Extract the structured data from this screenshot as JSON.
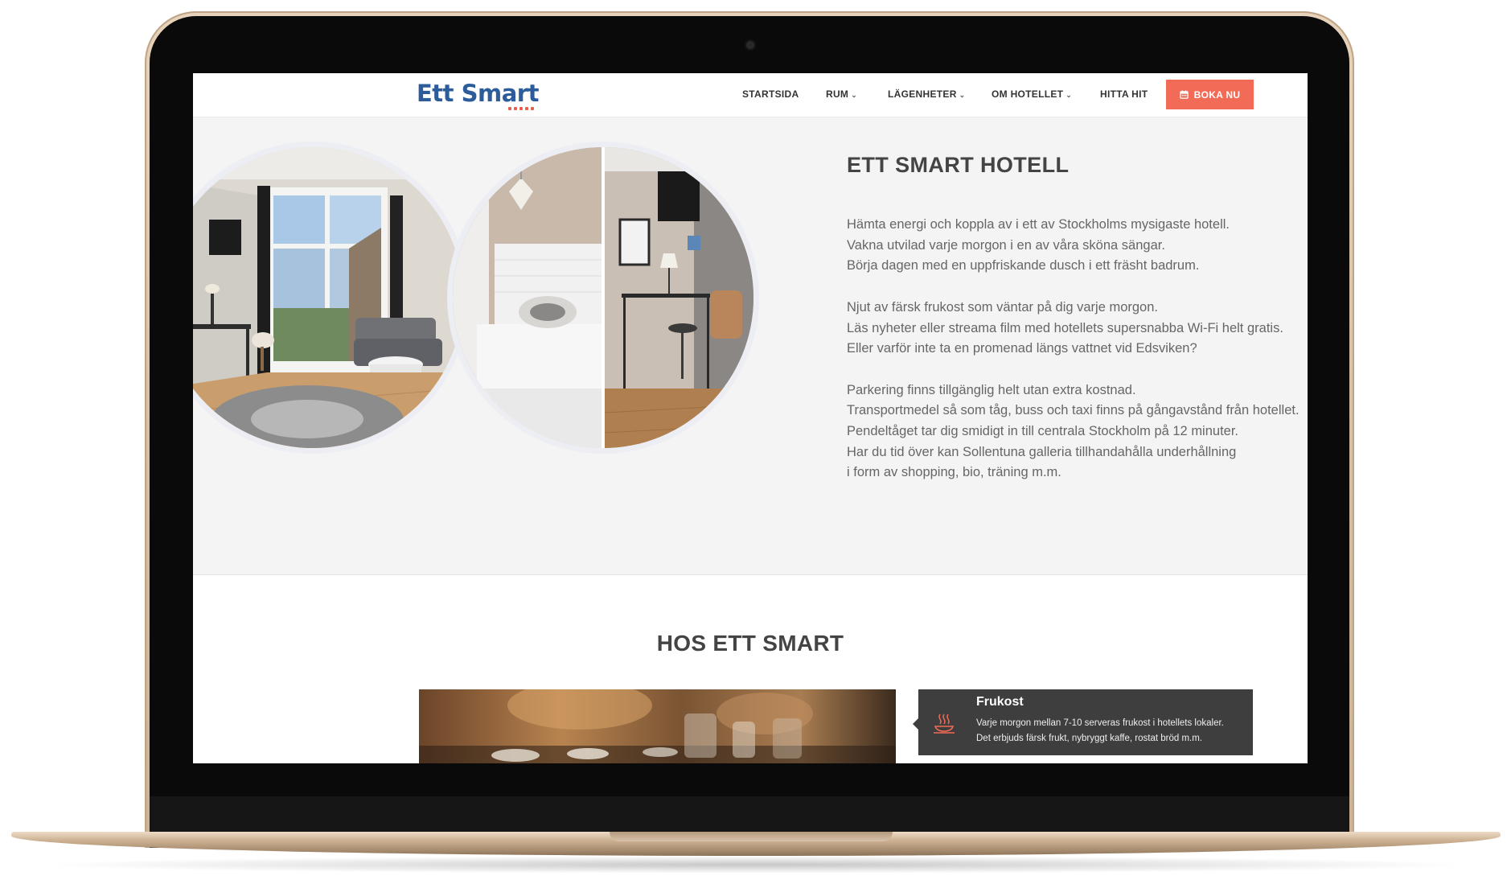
{
  "header": {
    "logo_text": "Ett Smart",
    "nav": [
      {
        "label": "STARTSIDA",
        "has_dropdown": false
      },
      {
        "label": "RUM",
        "has_dropdown": true
      },
      {
        "label": "LÄGENHETER",
        "has_dropdown": true
      },
      {
        "label": "OM HOTELLET",
        "has_dropdown": true
      },
      {
        "label": "HITTA HIT",
        "has_dropdown": false
      }
    ],
    "cta_label": "BOKA NU",
    "cta_icon": "calendar-icon"
  },
  "hero": {
    "title": "ETT SMART HOTELL",
    "paragraphs": [
      [
        "Hämta energi och koppla av i ett av Stockholms mysigaste hotell.",
        "Vakna utvilad varje morgon i en av våra sköna sängar.",
        "Börja dagen med en uppfriskande dusch i ett fräsht badrum."
      ],
      [
        "Njut av färsk frukost som väntar på dig varje morgon.",
        "Läs nyheter eller streama film med hotellets supersnabba Wi-Fi helt gratis.",
        "Eller varför inte ta en promenad längs vattnet vid Edsviken?"
      ],
      [
        "Parkering finns tillgänglig helt utan extra kostnad.",
        "Transportmedel så som tåg, buss och taxi finns på gångavstånd från hotellet.",
        "Pendeltåget tar dig smidigt in till centrala Stockholm på 12 minuter.",
        "Har du tid över kan Sollentuna galleria tillhandahålla underhållning",
        "i form av shopping, bio, träning m.m."
      ]
    ]
  },
  "section2": {
    "title": "HOS ETT SMART",
    "card": {
      "title": "Frukost",
      "icon": "breakfast-icon",
      "lines": [
        "Varje morgon mellan 7-10 serveras frukost i hotellets lokaler.",
        "Det erbjuds färsk frukt, nybryggt kaffe, rostat bröd m.m."
      ]
    }
  },
  "colors": {
    "brand_blue": "#2c5c9a",
    "accent": "#f26b57",
    "card_bg": "#3e3e3e"
  }
}
